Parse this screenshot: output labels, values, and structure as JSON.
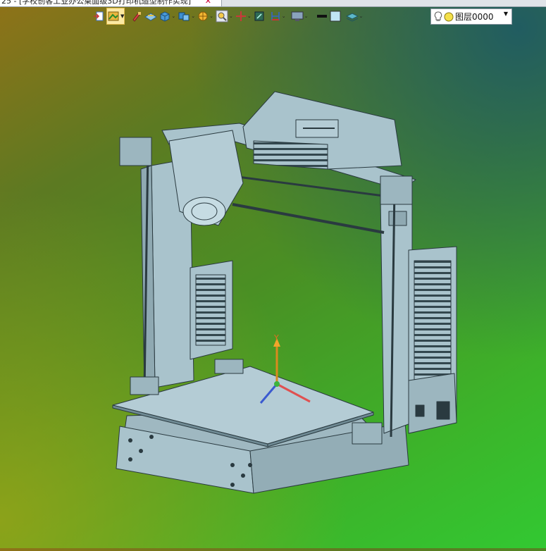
{
  "document_tab": {
    "title": "25 - [学校创客工业办公桌面级3D打印机造型制作实现]",
    "close_glyph": "✕"
  },
  "toolbar": {
    "buttons": [
      {
        "name": "exit-sketch-icon"
      },
      {
        "name": "render-style-icon",
        "active": true,
        "dropdown": true
      },
      {
        "name": "brush-icon"
      },
      {
        "name": "surface-icon"
      },
      {
        "name": "solid-view-icon",
        "dropdown": true
      },
      {
        "name": "view-orientation-icon",
        "dropdown": true
      },
      {
        "name": "section-icon",
        "dropdown": true
      },
      {
        "name": "zoom-icon",
        "dropdown": true
      },
      {
        "name": "pan-axis-icon",
        "dropdown": true
      },
      {
        "name": "fit-view-icon"
      },
      {
        "name": "dimension-icon",
        "dropdown": true
      },
      {
        "name": "display-icon",
        "dropdown": true
      },
      {
        "name": "line-color-icon"
      },
      {
        "name": "fill-color-icon"
      },
      {
        "name": "layers-icon",
        "dropdown": true
      }
    ],
    "layer_select": {
      "value": "图层0000",
      "arrow": "▼"
    }
  },
  "viewport": {
    "model_name": "3d-printer-model",
    "triad_label": "Y"
  },
  "colors": {
    "model": "#a9c3cc",
    "model_edge": "#2a3a40",
    "gradient_top_left": "#8f7218",
    "gradient_bottom_right": "#32c832"
  }
}
